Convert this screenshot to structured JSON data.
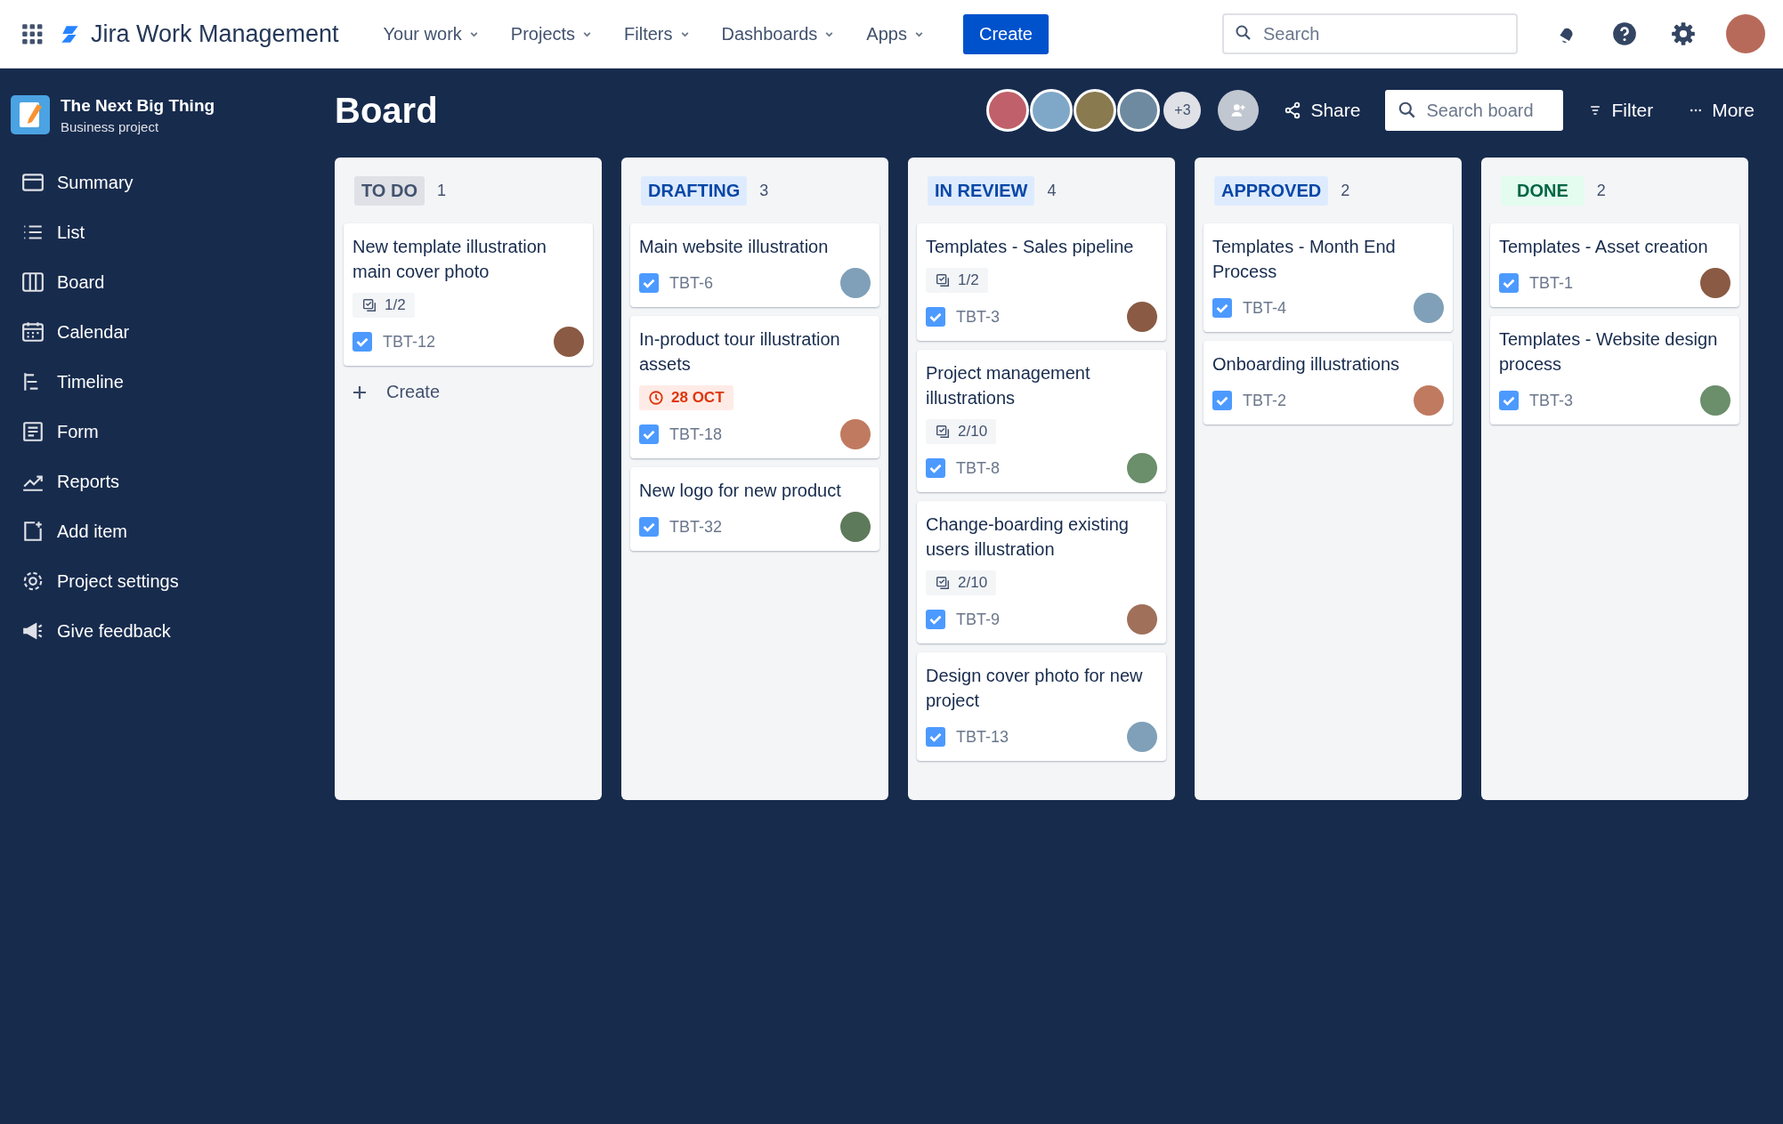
{
  "topbar": {
    "product": "Jira Work Management",
    "nav": [
      "Your work",
      "Projects",
      "Filters",
      "Dashboards",
      "Apps"
    ],
    "create": "Create",
    "search": {
      "placeholder": "Search"
    }
  },
  "sidebar": {
    "project": {
      "name": "The Next Big Thing",
      "type": "Business project"
    },
    "items": [
      {
        "label": "Summary",
        "kind": "summary"
      },
      {
        "label": "List",
        "kind": "list"
      },
      {
        "label": "Board",
        "kind": "board"
      },
      {
        "label": "Calendar",
        "kind": "calendar"
      },
      {
        "label": "Timeline",
        "kind": "timeline"
      },
      {
        "label": "Form",
        "kind": "form"
      },
      {
        "label": "Reports",
        "kind": "reports"
      },
      {
        "label": "Add item",
        "kind": "add"
      },
      {
        "label": "Project settings",
        "kind": "settings"
      },
      {
        "label": "Give feedback",
        "kind": "feedback"
      }
    ]
  },
  "board": {
    "title": "Board",
    "more_people": "+3",
    "share": "Share",
    "search": {
      "placeholder": "Search board"
    },
    "filter": "Filter",
    "more": "More",
    "columns": [
      {
        "status": "TO DO",
        "kind": "todo",
        "count": "1",
        "create": "Create",
        "cards": [
          {
            "title": "New template illustration main cover photo",
            "subtasks": "1/2",
            "key": "TBT-12"
          }
        ]
      },
      {
        "status": "DRAFTING",
        "kind": "progress",
        "count": "3",
        "cards": [
          {
            "title": "Main website illustration",
            "key": "TBT-6"
          },
          {
            "title": "In-product tour illustration assets",
            "due": "28 OCT",
            "key": "TBT-18"
          },
          {
            "title": "New logo for new product",
            "key": "TBT-32"
          }
        ]
      },
      {
        "status": "IN REVIEW",
        "kind": "progress",
        "count": "4",
        "cards": [
          {
            "title": "Templates - Sales pipeline",
            "subtasks": "1/2",
            "key": "TBT-3"
          },
          {
            "title": "Project management illustrations",
            "subtasks": "2/10",
            "key": "TBT-8"
          },
          {
            "title": "Change-boarding existing users illustration",
            "subtasks": "2/10",
            "key": "TBT-9"
          },
          {
            "title": "Design cover photo for new project",
            "key": "TBT-13"
          }
        ]
      },
      {
        "status": "APPROVED",
        "kind": "progress",
        "count": "2",
        "cards": [
          {
            "title": "Templates - Month End Process",
            "key": "TBT-4"
          },
          {
            "title": "Onboarding illustrations",
            "key": "TBT-2"
          }
        ]
      },
      {
        "status": "DONE",
        "kind": "done",
        "count": "2",
        "cards": [
          {
            "title": "Templates - Asset creation",
            "key": "TBT-1"
          },
          {
            "title": "Templates - Website design process",
            "key": "TBT-3"
          }
        ]
      }
    ]
  }
}
